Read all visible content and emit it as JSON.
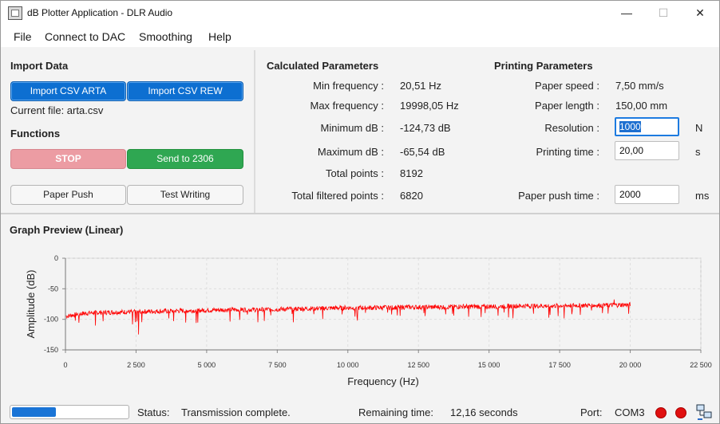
{
  "window": {
    "title": "dB Plotter Application - DLR Audio",
    "minimize": "—",
    "maximize": "☐",
    "close": "✕"
  },
  "menu": {
    "file": "File",
    "connect": "Connect to DAC",
    "smoothing": "Smoothing",
    "help": "Help"
  },
  "import": {
    "title": "Import Data",
    "arta_button": "Import CSV ARTA",
    "rew_button": "Import CSV REW",
    "current_file": "Current file: arta.csv"
  },
  "functions": {
    "title": "Functions",
    "stop": "STOP",
    "send": "Send to 2306",
    "paper_push": "Paper Push",
    "test_writing": "Test Writing"
  },
  "calculated": {
    "title": "Calculated Parameters",
    "rows": [
      {
        "label": "Min frequency :",
        "value": "20,51 Hz"
      },
      {
        "label": "Max frequency :",
        "value": "19998,05 Hz"
      },
      {
        "label": "Minimum dB :",
        "value": "-124,73 dB"
      },
      {
        "label": "Maximum dB :",
        "value": "-65,54 dB"
      },
      {
        "label": "Total points :",
        "value": "8192"
      },
      {
        "label": "Total filtered points :",
        "value": "6820"
      }
    ]
  },
  "printing": {
    "title": "Printing Parameters",
    "paper_speed_label": "Paper speed :",
    "paper_speed_value": "7,50 mm/s",
    "paper_length_label": "Paper length :",
    "paper_length_value": "150,00 mm",
    "resolution_label": "Resolution :",
    "resolution_value": "1000",
    "resolution_unit": "N",
    "printing_time_label": "Printing time :",
    "printing_time_value": "20,00",
    "printing_time_unit": "s",
    "paper_push_label": "Paper push time :",
    "paper_push_value": "2000",
    "paper_push_unit": "ms"
  },
  "graph": {
    "title": "Graph Preview (Linear)"
  },
  "chart_data": {
    "type": "line",
    "title": "Graph Preview (Linear)",
    "xlabel": "Frequency (Hz)",
    "ylabel": "Amplitude (dB)",
    "xlim": [
      0,
      22500
    ],
    "ylim": [
      -150,
      0
    ],
    "xticks": [
      0,
      2500,
      5000,
      7500,
      10000,
      12500,
      15000,
      17500,
      20000,
      22500
    ],
    "xtick_labels": [
      "0",
      "2 500",
      "5 000",
      "7 500",
      "10 000",
      "12 500",
      "15 000",
      "17 500",
      "20 000",
      "22 500"
    ],
    "yticks": [
      0,
      -50,
      -100,
      -150
    ],
    "ytick_labels": [
      "0",
      "-50",
      "-100",
      "-150"
    ],
    "grid": true,
    "series": [
      {
        "color": "#ff0000",
        "x": [
          20,
          500,
          1000,
          2000,
          3000,
          4000,
          5000,
          6000,
          7000,
          8000,
          9000,
          10000,
          11000,
          12000,
          13000,
          14000,
          15000,
          16000,
          17000,
          18000,
          19000,
          20000
        ],
        "y": [
          -95,
          -91,
          -89,
          -88,
          -87,
          -86,
          -85,
          -84,
          -84,
          -83,
          -82,
          -81,
          -81,
          -80,
          -80,
          -79,
          -79,
          -78,
          -78,
          -77,
          -77,
          -76
        ],
        "min_y": -124.73,
        "max_y": -65.54
      }
    ]
  },
  "status": {
    "progress": 0.38,
    "status_label": "Status:",
    "status_value": "Transmission complete.",
    "remaining_label": "Remaining time:",
    "remaining_value": "12,16 seconds",
    "port_label": "Port:",
    "port_value": "COM3"
  }
}
